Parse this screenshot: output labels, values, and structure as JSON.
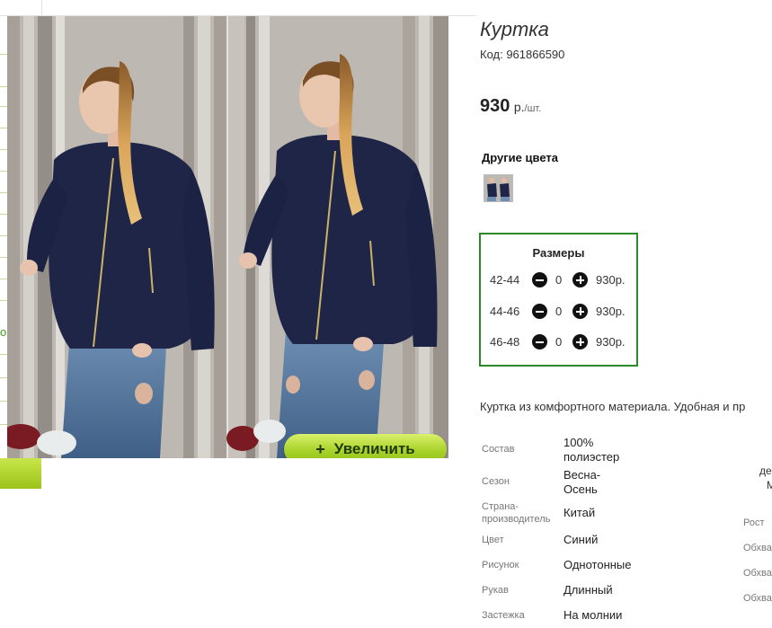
{
  "left_edge": {
    "green_letter": "o"
  },
  "product": {
    "title": "Куртка",
    "code": "Код: 961866590",
    "price": {
      "value": "930",
      "currency": "р.",
      "unit": "/шт."
    },
    "other_colors_label": "Другие цвета",
    "zoom_button": {
      "icon": "plus-icon",
      "plus": "+",
      "label": "Увеличить"
    }
  },
  "sizes": {
    "header": "Размеры",
    "rows": [
      {
        "size": "42-44",
        "qty": "0",
        "price": "930р."
      },
      {
        "size": "44-46",
        "qty": "0",
        "price": "930р."
      },
      {
        "size": "46-48",
        "qty": "0",
        "price": "930р."
      }
    ]
  },
  "description": "Куртка из комфортного материала. Удобная и пр",
  "properties": [
    {
      "label": "Состав",
      "value": "100% полиэстер"
    },
    {
      "label": "Сезон",
      "value": "Весна-Осень"
    },
    {
      "label": "Страна-производитель",
      "value": "Китай"
    },
    {
      "label": "Цвет",
      "value": "Синий"
    },
    {
      "label": "Рисунок",
      "value": "Однотонные"
    },
    {
      "label": "Рукав",
      "value": "Длинный"
    },
    {
      "label": "Застежка",
      "value": "На молнии"
    }
  ],
  "side_column": {
    "top1": "де",
    "top2": "М",
    "labels": [
      "Рост",
      "Обхва",
      "Обхва",
      "Обхва"
    ]
  },
  "colors": {
    "border": "#2a8a2a",
    "accent": "#a8d22a",
    "jacket": "#1f2547"
  }
}
